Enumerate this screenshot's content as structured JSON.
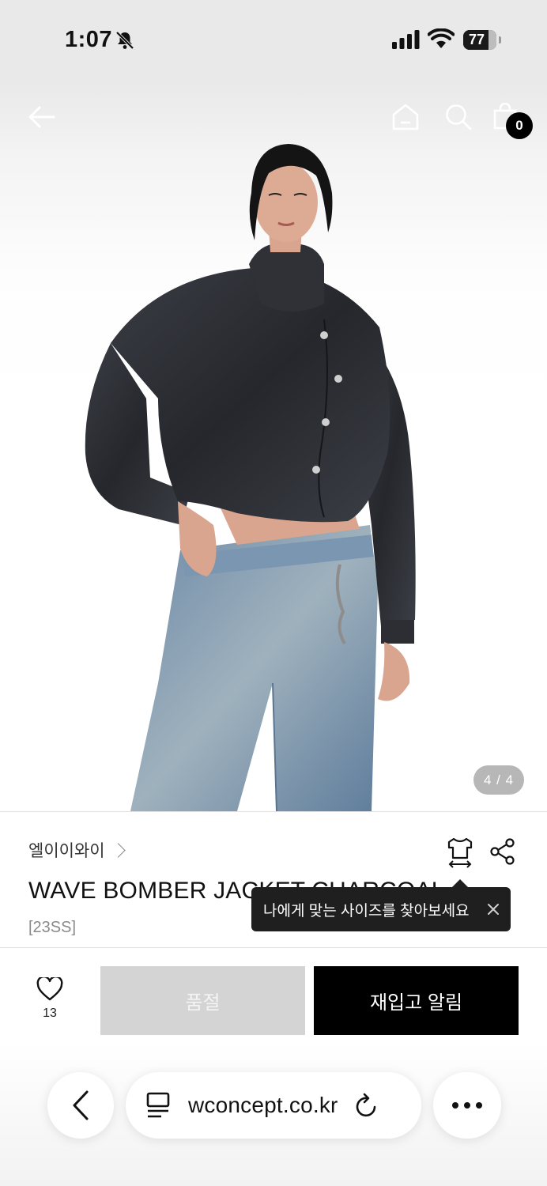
{
  "status_bar": {
    "time": "1:07",
    "battery": "77",
    "battery_level": 0.77
  },
  "header": {
    "cart_count": "0"
  },
  "gallery": {
    "counter": "4 / 4"
  },
  "product": {
    "brand": "엘이이와이",
    "title": "WAVE BOMBER JACKET CHARCOAL",
    "season": "[23SS]"
  },
  "tooltip": {
    "text": "나에게 맞는 사이즈를 찾아보세요"
  },
  "actions": {
    "like_count": "13",
    "soldout_label": "품절",
    "restock_label": "재입고 알림"
  },
  "browser": {
    "url": "wconcept.co.kr"
  },
  "icons": [
    "back-arrow-icon",
    "home-icon",
    "search-icon",
    "cart-icon",
    "size-guide-icon",
    "share-icon",
    "heart-icon",
    "close-icon",
    "reader-icon",
    "reload-icon",
    "more-icon",
    "muted-bell-icon",
    "signal-icon",
    "wifi-icon"
  ]
}
